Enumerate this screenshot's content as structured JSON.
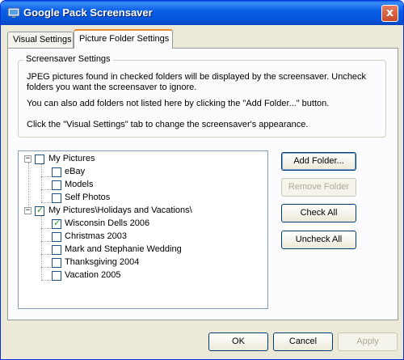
{
  "window": {
    "title": "Google Pack Screensaver",
    "close_glyph": "x"
  },
  "tabs": [
    {
      "label": "Visual Settings",
      "active": false
    },
    {
      "label": "Picture Folder Settings",
      "active": true
    }
  ],
  "group": {
    "legend": "Screensaver Settings",
    "line1": "JPEG pictures found in checked folders will be displayed by the screensaver.  Uncheck",
    "line2": "folders you want the screensaver to ignore.",
    "line3": "You can also add folders not listed here by clicking the \"Add Folder...\" button.",
    "line4": "Click the \"Visual Settings\" tab to change the screensaver's appearance."
  },
  "tree": {
    "root1": {
      "label": "My Pictures",
      "checked": false,
      "expander": "−"
    },
    "root1_children": [
      {
        "label": "eBay",
        "checked": false
      },
      {
        "label": "Models",
        "checked": false
      },
      {
        "label": "Self Photos",
        "checked": false
      }
    ],
    "root2": {
      "label": "My Pictures\\Holidays and Vacations\\",
      "checked": true,
      "expander": "−"
    },
    "root2_children": [
      {
        "label": "Wisconsin Dells 2006",
        "checked": true
      },
      {
        "label": "Christmas 2003",
        "checked": false
      },
      {
        "label": "Mark and Stephanie Wedding",
        "checked": false
      },
      {
        "label": "Thanksgiving 2004",
        "checked": false
      },
      {
        "label": "Vacation 2005",
        "checked": false
      }
    ],
    "check_glyph": "✓"
  },
  "side_buttons": {
    "add_folder": "Add Folder...",
    "remove_folder": "Remove Folder",
    "check_all": "Check All",
    "uncheck_all": "Uncheck All"
  },
  "dialog_buttons": {
    "ok": "OK",
    "cancel": "Cancel",
    "apply": "Apply"
  },
  "colors": {
    "title_bar": "#0553d9",
    "face": "#ece9d8",
    "tab_highlight": "#e68b2c",
    "check": "#21a121"
  }
}
